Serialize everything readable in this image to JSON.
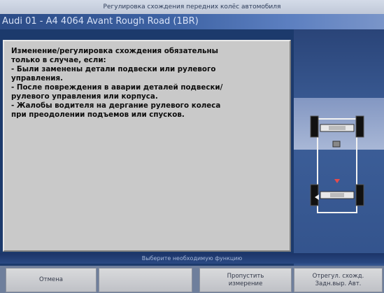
{
  "window": {
    "title": "Регулировка схождения передних колёс автомобиля"
  },
  "vehicle": {
    "label": "Audi 01 - A4 4064 Avant Rough Road (1BR)"
  },
  "dialog": {
    "lines": [
      "Изменение/регулировка схождения обязательны",
      "только в случае, если:",
      "- Были заменены детали подвески или рулевого",
      "управления.",
      "- После повреждения в аварии деталей подвески/",
      "рулевого управления или корпуса.",
      "- Жалобы водителя на дергание рулевого колеса",
      "при преодолении подъемов или спусков."
    ]
  },
  "status": {
    "text": "Выберите необходимую функцию"
  },
  "buttons": {
    "cancel": "Отмена",
    "empty": "",
    "skip_line1": "Пропустить",
    "skip_line2": "измерение",
    "adjust_line1": "Отрегул. схожд.",
    "adjust_line2": "Задн.выр. Авт."
  },
  "icons": {
    "diagram": "wheel-alignment-icon"
  },
  "colors": {
    "background": "#1c3a6c",
    "dialog": "#c9c9c9",
    "vehicle_bar": "#3e63a4"
  }
}
